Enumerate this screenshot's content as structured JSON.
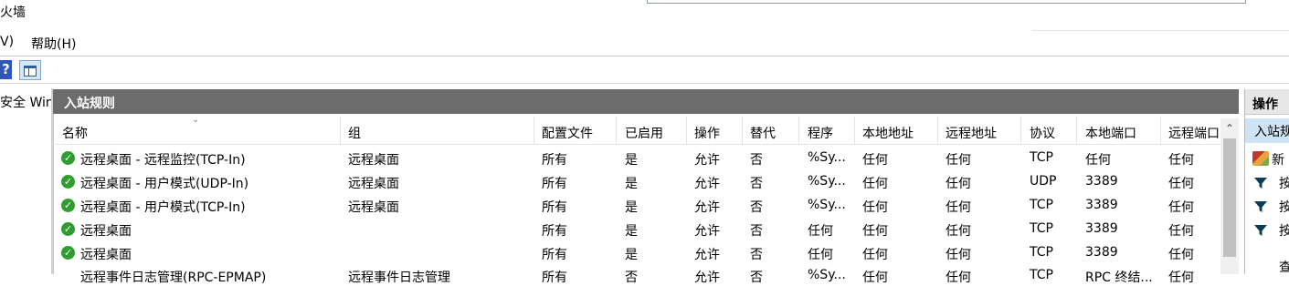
{
  "window": {
    "title": "火墙"
  },
  "menu": [
    {
      "label": "V)",
      "name": "menu-view"
    },
    {
      "label": "帮助(H)",
      "name": "menu-help"
    }
  ],
  "toolbar": {
    "help_icon": "help-icon",
    "console_icon": "show-hide-console-tree-icon"
  },
  "tree": {
    "selected_label": "安全 Win"
  },
  "main": {
    "title": "入站规则",
    "columns": [
      "名称",
      "组",
      "配置文件",
      "已启用",
      "操作",
      "替代",
      "程序",
      "本地地址",
      "远程地址",
      "协议",
      "本地端口",
      "远程端口"
    ],
    "rows": [
      {
        "name": "远程桌面 - 远程监控(TCP-In)",
        "group": "远程桌面",
        "profile": "所有",
        "enabled": "是",
        "action": "允许",
        "override": "否",
        "program": "%Sy...",
        "local_addr": "任何",
        "remote_addr": "任何",
        "protocol": "TCP",
        "local_port": "任何",
        "remote_port": "任何"
      },
      {
        "name": "远程桌面 - 用户模式(UDP-In)",
        "group": "远程桌面",
        "profile": "所有",
        "enabled": "是",
        "action": "允许",
        "override": "否",
        "program": "%Sy...",
        "local_addr": "任何",
        "remote_addr": "任何",
        "protocol": "UDP",
        "local_port": "3389",
        "remote_port": "任何"
      },
      {
        "name": "远程桌面 - 用户模式(TCP-In)",
        "group": "远程桌面",
        "profile": "所有",
        "enabled": "是",
        "action": "允许",
        "override": "否",
        "program": "%Sy...",
        "local_addr": "任何",
        "remote_addr": "任何",
        "protocol": "TCP",
        "local_port": "3389",
        "remote_port": "任何"
      },
      {
        "name": "远程桌面",
        "group": "",
        "profile": "所有",
        "enabled": "是",
        "action": "允许",
        "override": "否",
        "program": "任何",
        "local_addr": "任何",
        "remote_addr": "任何",
        "protocol": "TCP",
        "local_port": "3389",
        "remote_port": "任何"
      },
      {
        "name": "远程桌面",
        "group": "",
        "profile": "所有",
        "enabled": "是",
        "action": "允许",
        "override": "否",
        "program": "任何",
        "local_addr": "任何",
        "remote_addr": "任何",
        "protocol": "TCP",
        "local_port": "3389",
        "remote_port": "任何"
      },
      {
        "name": "远程事件日志管理(RPC-EPMAP)",
        "group": "远程事件日志管理",
        "profile": "所有",
        "enabled": "否",
        "action": "允许",
        "override": "否",
        "program": "%Sy...",
        "local_addr": "任何",
        "remote_addr": "任何",
        "protocol": "TCP",
        "local_port": "RPC 终结...",
        "remote_port": "任何"
      }
    ]
  },
  "actions": {
    "title": "操作",
    "section": "入站规",
    "items": [
      {
        "label": "新",
        "icon": "new-rule-wizard-icon"
      },
      {
        "label": "按",
        "icon": "filter-icon"
      },
      {
        "label": "按",
        "icon": "filter-icon"
      },
      {
        "label": "按",
        "icon": "filter-icon"
      },
      {
        "label": "查",
        "icon": ""
      }
    ]
  }
}
